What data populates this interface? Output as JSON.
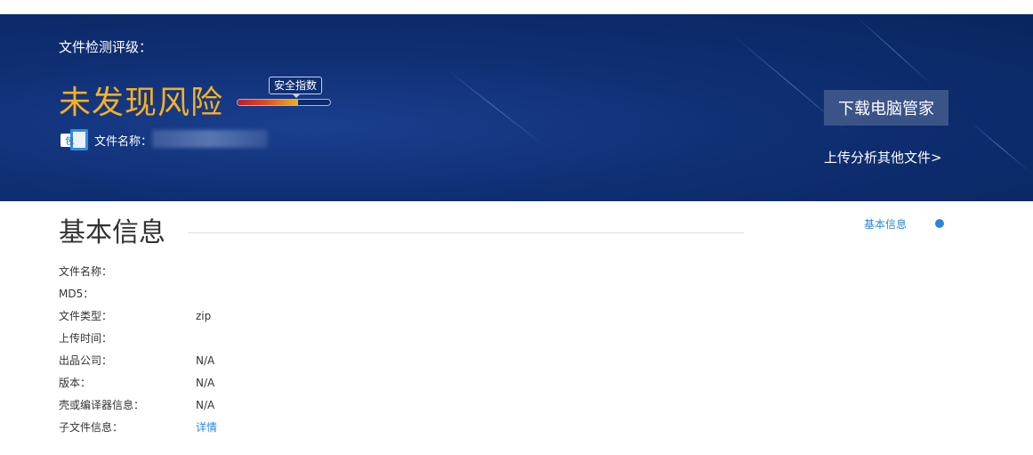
{
  "banner": {
    "rating_title": "文件检测评级：",
    "risk_result": "未发现风险",
    "meter_label": "安全指数",
    "meter_level": 0.65,
    "file_icon_text": "包",
    "file_name_label": "文件名称：",
    "download_button": "下载电脑管家",
    "upload_link": "上传分析其他文件>"
  },
  "section": {
    "title": "基本信息"
  },
  "side_nav": {
    "label": "基本信息"
  },
  "info": [
    {
      "key": "文件名称：",
      "value": ""
    },
    {
      "key": "MD5：",
      "value": ""
    },
    {
      "key": "文件类型：",
      "value": "zip"
    },
    {
      "key": "上传时间：",
      "value": ""
    },
    {
      "key": "出品公司：",
      "value": "N/A"
    },
    {
      "key": "版本：",
      "value": "N/A"
    },
    {
      "key": "壳或编译器信息：",
      "value": "N/A"
    },
    {
      "key": "子文件信息：",
      "value": "详情"
    }
  ],
  "colors": {
    "banner_bg": "#0f2f73",
    "risk_text": "#f6b023",
    "link": "#2b86d8",
    "button_bg": "#3b5488"
  }
}
